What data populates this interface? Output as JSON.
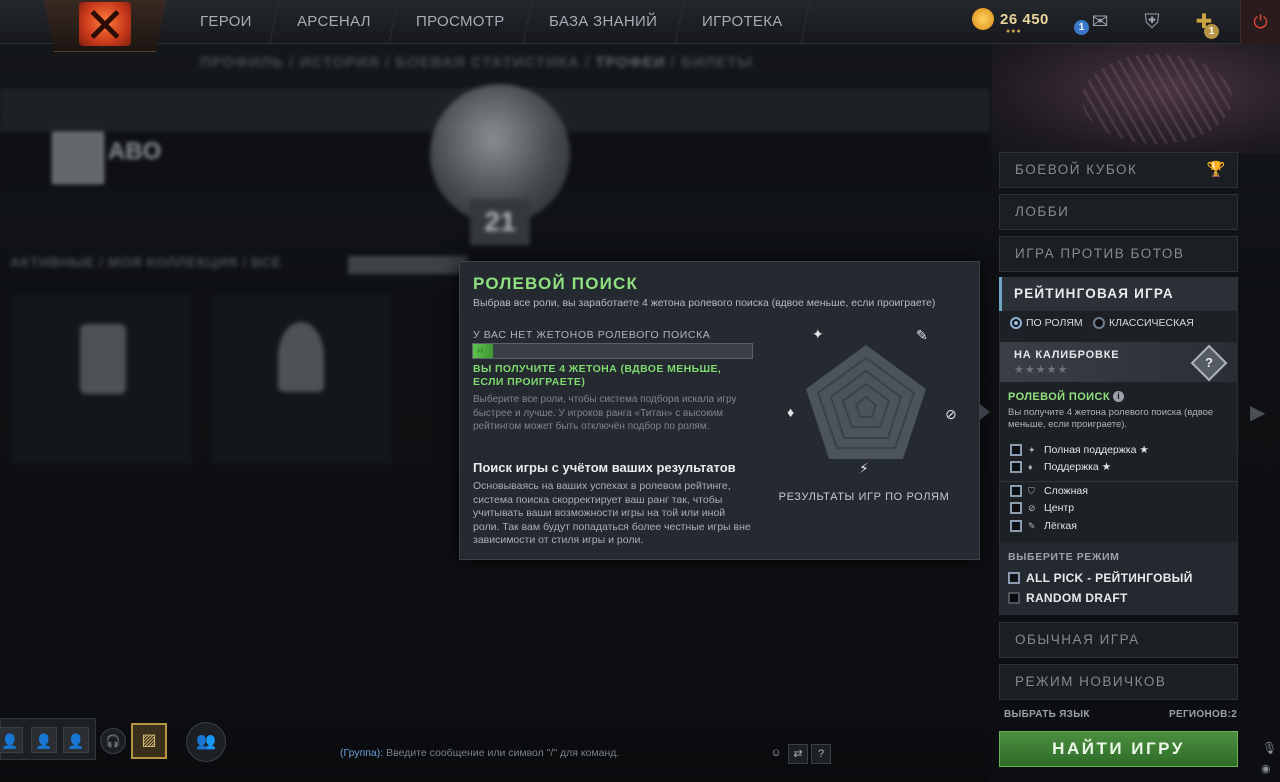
{
  "nav": {
    "items": [
      "ГЕРОИ",
      "АРСЕНАЛ",
      "ПРОСМОТР",
      "БАЗА ЗНАНИЙ",
      "ИГРОТЕКА"
    ],
    "shards": "26 450",
    "mail_badge": "1",
    "plus_badge": "1"
  },
  "background": {
    "subnav": "ПРОФИЛЬ  /  ИСТОРИЯ  /  БОЕВАЯ СТАТИСТИКА  /",
    "subnav_active": "ТРОФЕИ",
    "subnav_after": "/  БИЛЕТЫ",
    "profile_name": "ABO",
    "medal_level": "21",
    "collection_tabs": "АКТИВНЫЕ  /  МОЯ КОЛЛЕКЦИЯ  /  ВСЕ"
  },
  "popup": {
    "title": "РОЛЕВОЙ ПОИСК",
    "subtitle": "Выбрав все роли, вы заработаете 4 жетона ролевого поиска (вдвое меньше, если проиграете)",
    "tokens_label": "У ВАС НЕТ ЖЕТОНОВ РОЛЕВОГО ПОИСКА",
    "tokens_bar_text": "››",
    "tokens_progress": 0.07,
    "green_note": "ВЫ ПОЛУЧИТЕ 4 ЖЕТОНА (ВДВОЕ МЕНЬШЕ, ЕСЛИ ПРОИГРАЕТЕ)",
    "gray_note": "Выберите все роли, чтобы система подбора искала игру быстрее и лучше. У игроков ранга «Титан» с высоким рейтингом может быть отключён подбор по ролям.",
    "heading2": "Поиск игры с учётом ваших результатов",
    "body": "Основываясь на ваших успехах в ролевом рейтинге, система поиска скорректирует ваш ранг так, чтобы учитывать ваши возможности игры на той или иной роли. Так вам будут попадаться более честные игры вне зависимости от стиля игры и роли.",
    "radar_caption": "РЕЗУЛЬТАТЫ ИГР ПО РОЛЯМ"
  },
  "right_panel": {
    "modes_top": [
      "БОЕВОЙ КУБОК",
      "ЛОББИ",
      "ИГРА ПРОТИВ БОТОВ"
    ],
    "active_mode": "РЕЙТИНГОВАЯ ИГРА",
    "radio_roles": "ПО РОЛЯМ",
    "radio_classic": "КЛАССИЧЕСКАЯ",
    "calibration_title": "НА КАЛИБРОВКЕ",
    "calibration_stars": "★★★★★",
    "calibration_icon": "?",
    "role_search_title": "РОЛЕВОЙ ПОИСК",
    "role_search_sub": "Вы получите 4 жетона ролевого поиска (вдвое меньше, если проиграете).",
    "roles": [
      {
        "label": "Полная поддержка ★",
        "icon": "hard-support-icon"
      },
      {
        "label": "Поддержка ★",
        "icon": "support-icon"
      },
      {
        "label": "Сложная",
        "icon": "offlane-icon"
      },
      {
        "label": "Центр",
        "icon": "mid-icon"
      },
      {
        "label": "Лёгкая",
        "icon": "carry-icon"
      }
    ],
    "choose_mode_title": "ВЫБЕРИТЕ РЕЖИМ",
    "game_modes": [
      "ALL PICK - РЕЙТИНГОВЫЙ",
      "RANDOM DRAFT"
    ],
    "modes_bottom": [
      "ОБЫЧНАЯ ИГРА",
      "РЕЖИМ НОВИЧКОВ"
    ],
    "language": "ВЫБРАТЬ ЯЗЫК",
    "regions": "РЕГИОНОВ:2",
    "find_button": "НАЙТИ ИГРУ"
  },
  "chat": {
    "group": "(Группа):",
    "placeholder": "Введите сообщение или символ \"/\" для команд.",
    "help": "?"
  },
  "colors": {
    "accent_green": "#8fe07e",
    "find_button": "#3f7d35",
    "panel_bg": "#252a31"
  }
}
